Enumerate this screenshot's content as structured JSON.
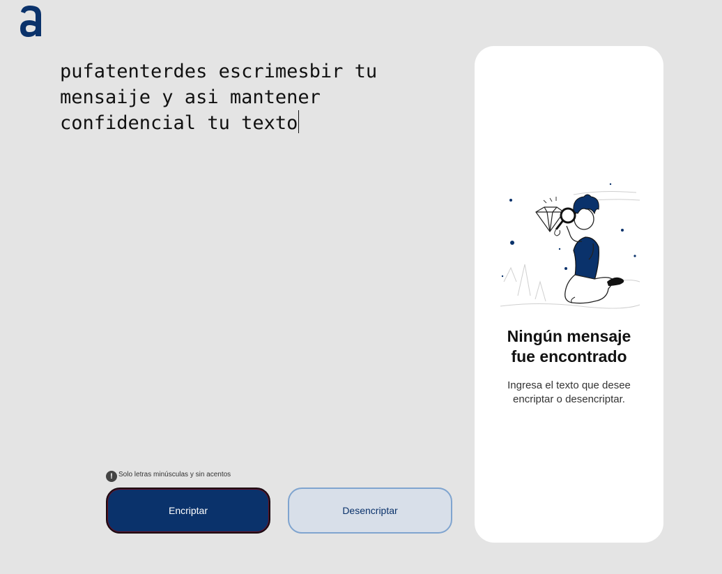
{
  "logo": {
    "icon": "alura-logo-icon",
    "color": "#0a326b"
  },
  "editor": {
    "text": "pufatenterdes escrimesbir tu mensaije y asi mantener confidencial tu texto"
  },
  "hint": {
    "icon": "exclamation-icon",
    "text": "Solo letras minúsculas y sin acentos"
  },
  "buttons": {
    "encrypt_label": "Encriptar",
    "decrypt_label": "Desencriptar"
  },
  "panel": {
    "illustration": "person-with-magnifier-illustration",
    "title_line1": "Ningún mensaje",
    "title_line2": "fue encontrado",
    "desc_line1": "Ingresa el texto que desee",
    "desc_line2": "encriptar o desencriptar."
  },
  "colors": {
    "accent": "#0a326b",
    "background": "#e4e4e4",
    "panel": "#ffffff"
  }
}
